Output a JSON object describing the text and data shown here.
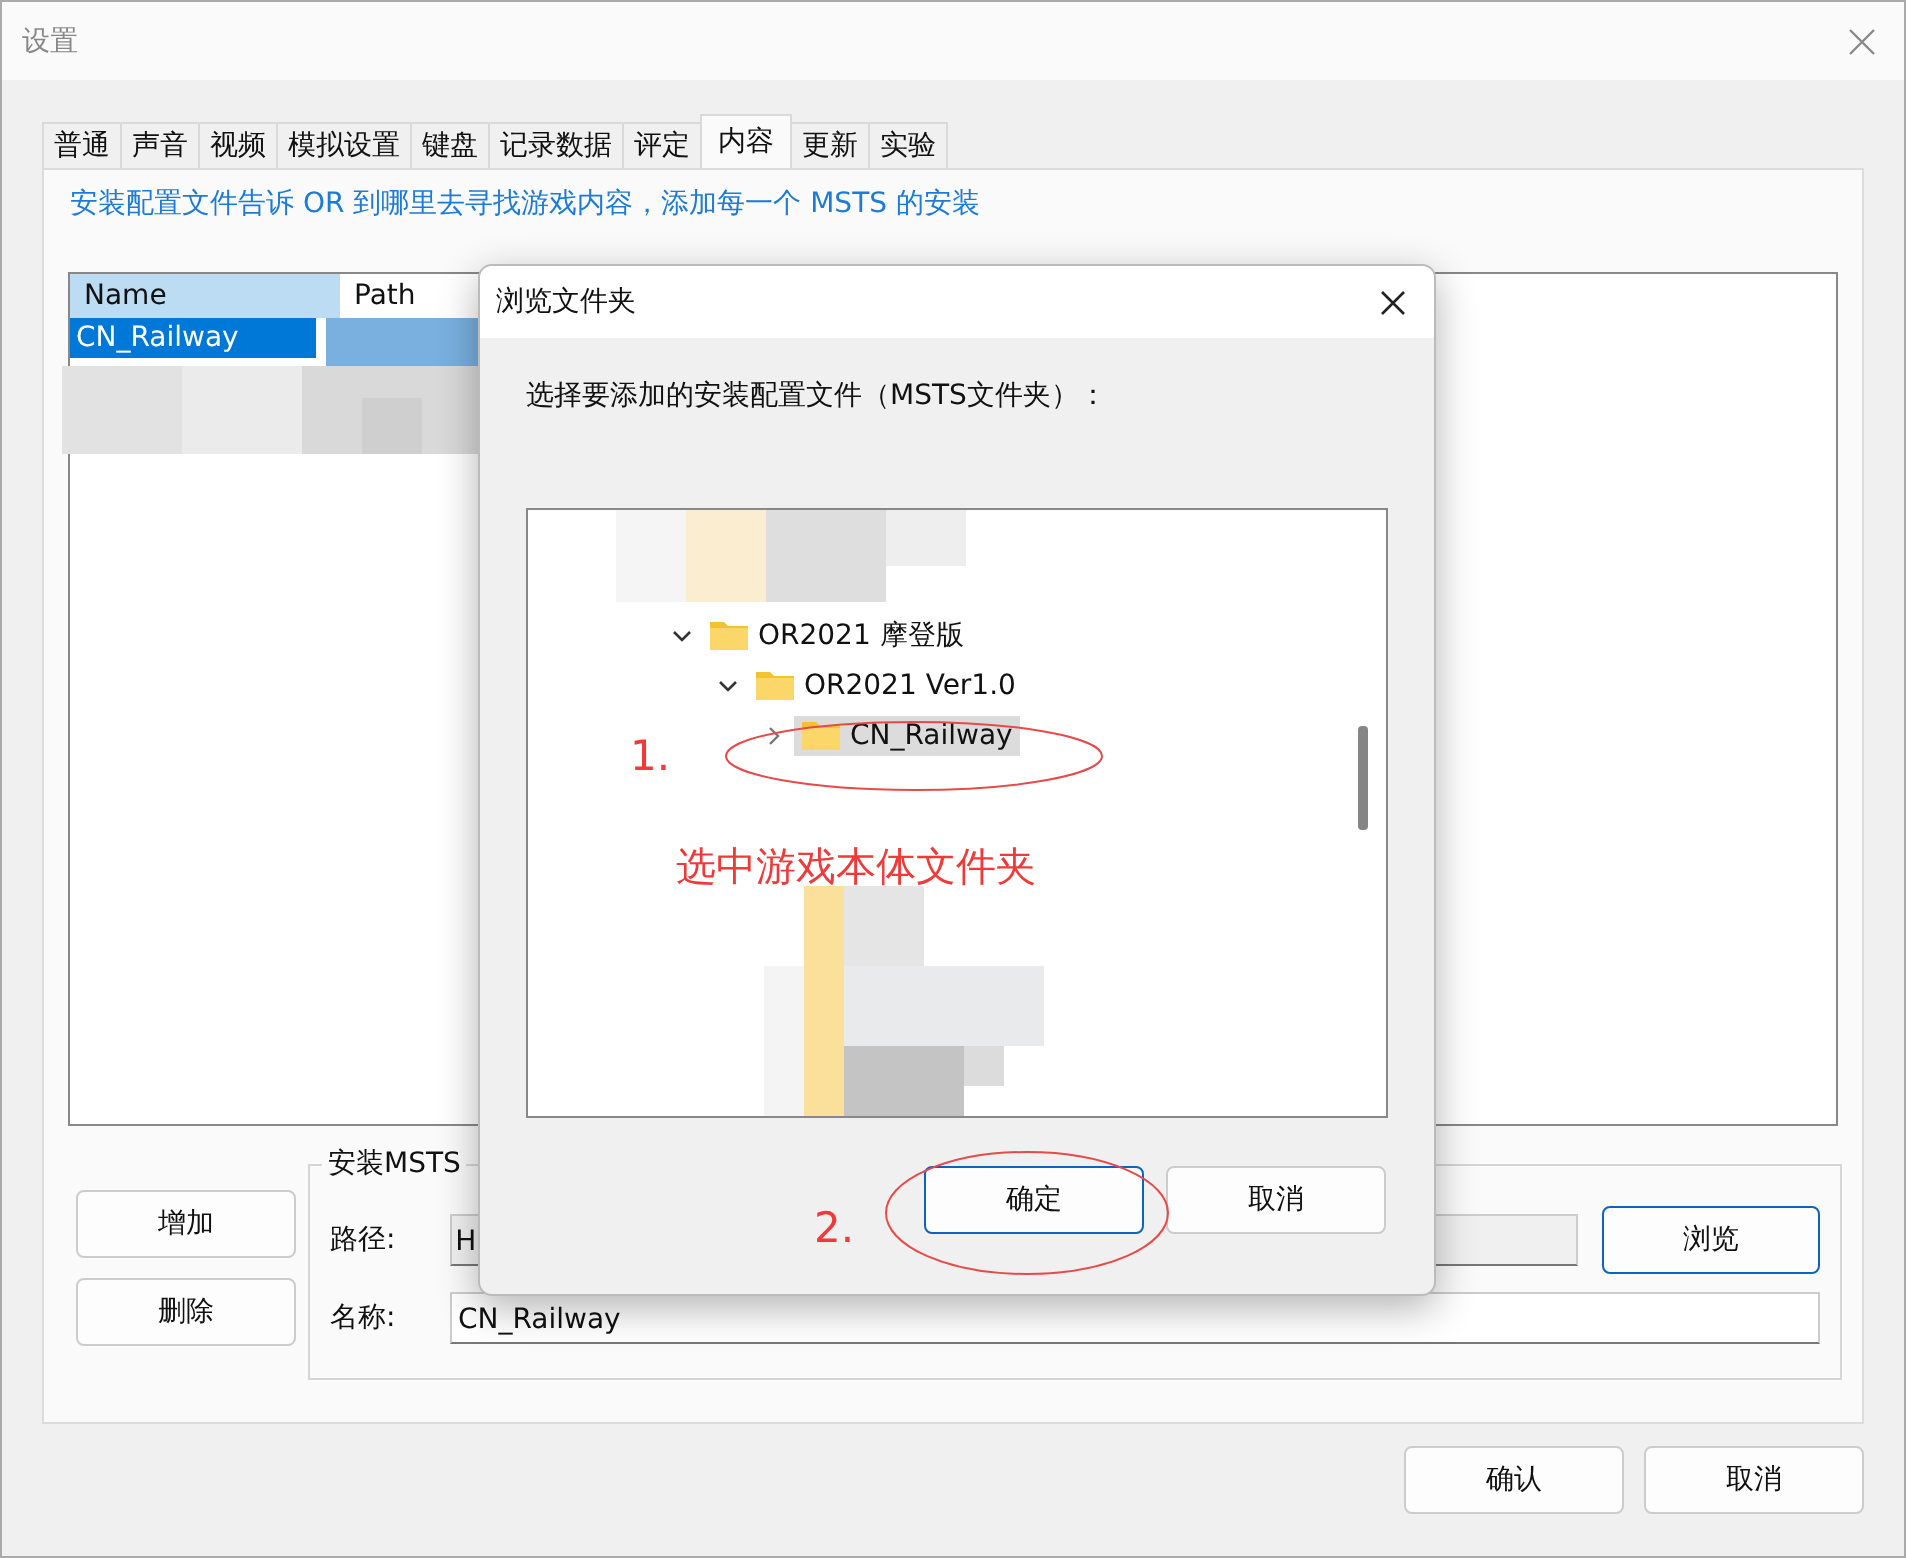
{
  "window": {
    "title": "设置"
  },
  "tabs": [
    {
      "label": "普通",
      "selected": false
    },
    {
      "label": "声音",
      "selected": false
    },
    {
      "label": "视频",
      "selected": false
    },
    {
      "label": "模拟设置",
      "selected": false
    },
    {
      "label": "键盘",
      "selected": false
    },
    {
      "label": "记录数据",
      "selected": false
    },
    {
      "label": "评定",
      "selected": false
    },
    {
      "label": "内容",
      "selected": true
    },
    {
      "label": "更新",
      "selected": false
    },
    {
      "label": "实验",
      "selected": false
    }
  ],
  "description": "安装配置文件告诉 OR 到哪里去寻找游戏内容，添加每一个 MSTS 的安装",
  "list": {
    "columns": [
      "Name",
      "Path"
    ],
    "rows": [
      {
        "name": "CN_Railway",
        "selected": true
      }
    ]
  },
  "side_buttons": [
    "增加",
    "删除"
  ],
  "group": {
    "legend": "安装MSTS",
    "path_label": "路径:",
    "path_value": "H",
    "browse_button": "浏览",
    "name_label": "名称:",
    "name_value": "CN_Railway"
  },
  "footer_buttons": [
    "确认",
    "取消"
  ],
  "dialog": {
    "title": "浏览文件夹",
    "prompt": "选择要添加的安装配置文件（MSTS文件夹）：",
    "tree": [
      {
        "label": "OR2021 摩登版",
        "expanded": true,
        "selected": false,
        "children": [
          {
            "label": "OR2021 Ver1.0",
            "expanded": true,
            "selected": false,
            "children": [
              {
                "label": "CN_Railway",
                "expanded": false,
                "selected": true
              }
            ]
          }
        ]
      }
    ],
    "buttons": [
      "确定",
      "取消"
    ]
  },
  "annotations": [
    {
      "kind": "step",
      "text": "1."
    },
    {
      "kind": "note",
      "text": "选中游戏本体文件夹"
    },
    {
      "kind": "step",
      "text": "2."
    }
  ]
}
